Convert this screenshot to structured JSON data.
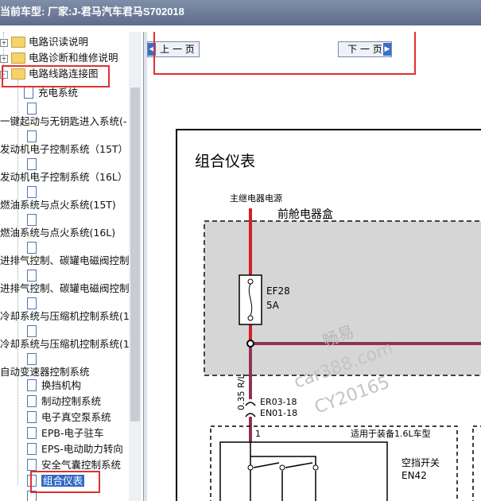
{
  "header": {
    "title": "当前车型:  厂家:J-君马汽车君马S702018"
  },
  "nav": {
    "prev_label": "上 一 页",
    "next_label": "下 一 页"
  },
  "tree": {
    "items": [
      {
        "label": "电路识读说明",
        "type": "folder"
      },
      {
        "label": "电路诊断和维修说明",
        "type": "folder"
      },
      {
        "label": "电路线路连接图",
        "type": "folder-open"
      },
      {
        "label": "充电系统",
        "type": "doc"
      },
      {
        "label": "一键起动与无钥匙进入系统(-",
        "type": "text"
      },
      {
        "label": "发动机电子控制系统（15T）",
        "type": "text"
      },
      {
        "label": "发动机电子控制系统（16L）",
        "type": "text"
      },
      {
        "label": "燃油系统与点火系统(15T)",
        "type": "text"
      },
      {
        "label": "燃油系统与点火系统(16L)",
        "type": "text"
      },
      {
        "label": "进排气控制、碳罐电磁阀控制",
        "type": "text"
      },
      {
        "label": "进排气控制、碳罐电磁阀控制",
        "type": "text"
      },
      {
        "label": "冷却系统与压缩机控制系统(1",
        "type": "text"
      },
      {
        "label": "冷却系统与压缩机控制系统(1",
        "type": "text"
      },
      {
        "label": "自动变速器控制系统",
        "type": "text"
      },
      {
        "label": "换挡机构",
        "type": "doc"
      },
      {
        "label": "制动控制系统",
        "type": "doc"
      },
      {
        "label": "电子真空泵系统",
        "type": "doc"
      },
      {
        "label": "EPB-电子驻车",
        "type": "doc"
      },
      {
        "label": "EPS-电动助力转向",
        "type": "doc"
      },
      {
        "label": "安全气囊控制系统",
        "type": "doc"
      },
      {
        "label": "组合仪表",
        "type": "doc-selected"
      }
    ]
  },
  "diagram": {
    "title": "组合仪表",
    "source_label": "主继电器电源",
    "box_label": "前舱电器盒",
    "fuse_name": "EF28",
    "fuse_rating": "5A",
    "wire_label": "0.35 R/L",
    "connector_1": "ER03-18",
    "connector_2": "EN01-18",
    "pin": "1",
    "applies_label": "适用于装备1.6L车型",
    "switch_label": "空挡开关",
    "switch_code": "EN42",
    "watermark_1": "畅易",
    "watermark_2": "car388.com",
    "watermark_3": "CY20165"
  },
  "colors": {
    "highlight": "#e03030",
    "wire_red": "#d42020",
    "wire_blue": "#2a4fb0",
    "selection": "#316ac5"
  }
}
